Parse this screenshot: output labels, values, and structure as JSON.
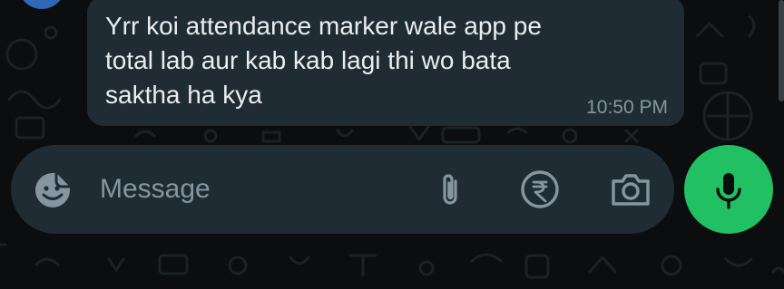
{
  "conversation": {
    "message": {
      "text": "Yrr koi attendance marker wale app pe\ntotal lab aur kab kab lagi thi wo bata\nsaktha ha kya",
      "time": "10:50 PM"
    }
  },
  "composer": {
    "placeholder": "Message",
    "icons": {
      "emoji": "sticker-emoji-icon",
      "attach": "paperclip-icon",
      "payment": "rupee-icon",
      "camera": "camera-icon",
      "mic": "microphone-icon"
    }
  },
  "colors": {
    "background": "#0b0d0e",
    "bubble": "#1f2c34",
    "text": "#e9edef",
    "muted": "#8696a0",
    "accent": "#21c063"
  }
}
